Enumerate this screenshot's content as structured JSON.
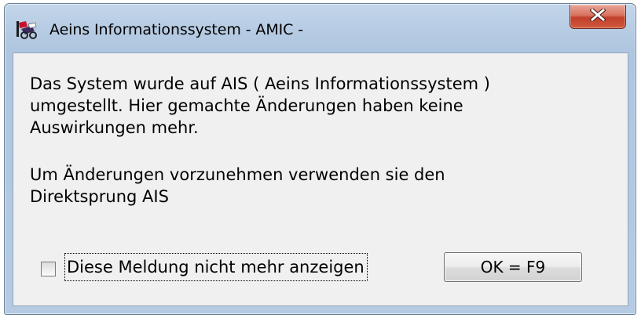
{
  "window": {
    "title": "Aeins Informationssystem - AMIC -",
    "app_icon": "app-logo-icon",
    "close_icon": "close-icon",
    "close_button_color": "#c1402a"
  },
  "message": {
    "paragraph1": [
      "Das System wurde auf AIS ( Aeins Informationssystem )",
      "umgestellt. Hier gemachte Änderungen haben keine",
      "Auswirkungen mehr."
    ],
    "paragraph2": [
      "Um Änderungen vorzunehmen verwenden sie den",
      "Direktsprung AIS"
    ]
  },
  "checkbox": {
    "label": "Diese Meldung nicht mehr anzeigen",
    "checked": false
  },
  "ok_button": {
    "label": "OK = F9"
  }
}
